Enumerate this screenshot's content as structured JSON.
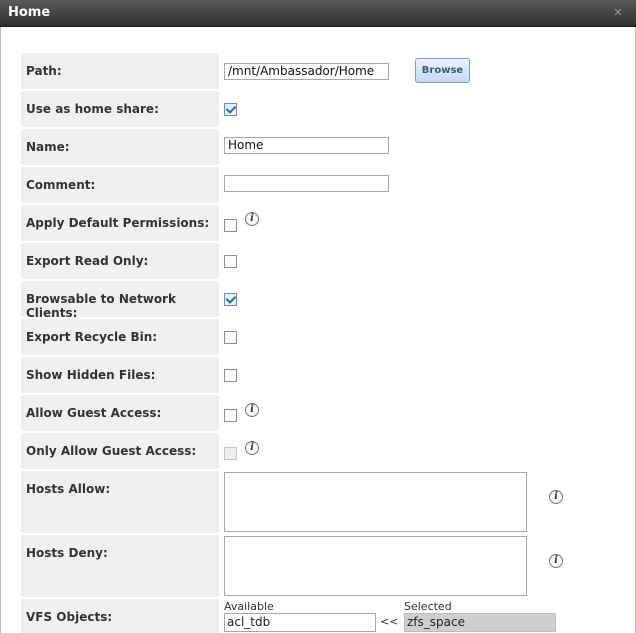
{
  "dialog": {
    "title": "Home"
  },
  "form": {
    "path_label": "Path:",
    "path_value": "/mnt/Ambassador/Home",
    "browse_label": "Browse",
    "home_share_label": "Use as home share:",
    "home_share_checked": true,
    "name_label": "Name:",
    "name_value": "Home",
    "comment_label": "Comment:",
    "comment_value": "",
    "default_perms_label": "Apply Default Permissions:",
    "default_perms_checked": false,
    "read_only_label": "Export Read Only:",
    "read_only_checked": false,
    "browsable_label": "Browsable to Network Clients:",
    "browsable_checked": true,
    "recycle_label": "Export Recycle Bin:",
    "recycle_checked": false,
    "hidden_label": "Show Hidden Files:",
    "hidden_checked": false,
    "guest_label": "Allow Guest Access:",
    "guest_checked": false,
    "only_guest_label": "Only Allow Guest Access:",
    "only_guest_checked": false,
    "hosts_allow_label": "Hosts Allow:",
    "hosts_deny_label": "Hosts Deny:",
    "vfs_label": "VFS Objects:",
    "vfs_available_label": "Available",
    "vfs_selected_label": "Selected",
    "vfs_available_item": "acl_tdb",
    "vfs_selected_item": "zfs_space",
    "vfs_move_left": "<<"
  },
  "icons": {
    "close": "close-icon",
    "info": "info-icon"
  },
  "colors": {
    "titlebar": "#3d3d3d",
    "label_bg": "#f0f0f0",
    "button_accent": "#c4daf1"
  }
}
